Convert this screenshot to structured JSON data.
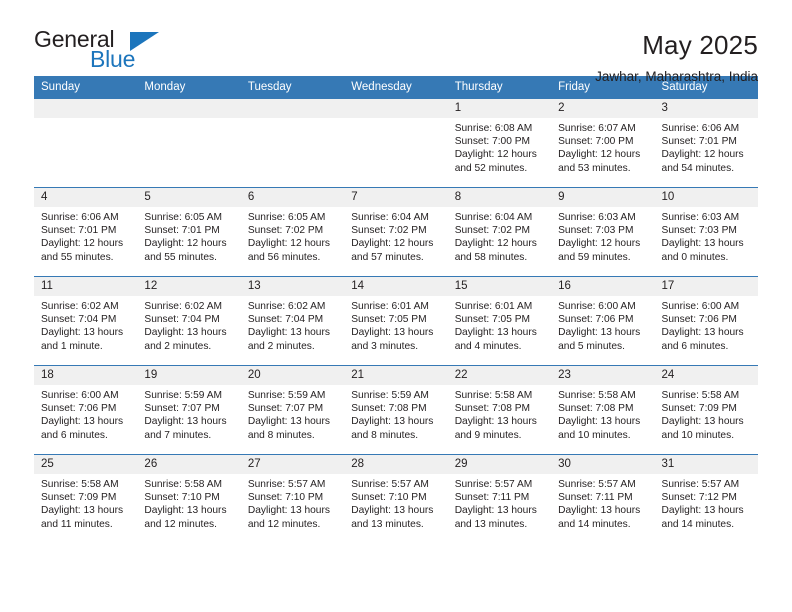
{
  "brand": {
    "name_part1": "General",
    "name_part2": "Blue",
    "accent_color": "#1c75bc"
  },
  "header": {
    "title": "May 2025",
    "subtitle": "Jawhar, Maharashtra, India"
  },
  "theme": {
    "header_bg": "#3679b5",
    "daynum_bg": "#f0f0f0",
    "text": "#231f20"
  },
  "weekday_headers": [
    "Sunday",
    "Monday",
    "Tuesday",
    "Wednesday",
    "Thursday",
    "Friday",
    "Saturday"
  ],
  "labels": {
    "sunrise_prefix": "Sunrise:",
    "sunset_prefix": "Sunset:",
    "daylight_prefix": "Daylight:"
  },
  "weeks": [
    [
      {
        "day": "",
        "empty": true,
        "lines": []
      },
      {
        "day": "",
        "empty": true,
        "lines": []
      },
      {
        "day": "",
        "empty": true,
        "lines": []
      },
      {
        "day": "",
        "empty": true,
        "lines": []
      },
      {
        "day": "1",
        "empty": false,
        "lines": [
          "Sunrise: 6:08 AM",
          "Sunset: 7:00 PM",
          "Daylight: 12 hours",
          "and 52 minutes."
        ]
      },
      {
        "day": "2",
        "empty": false,
        "lines": [
          "Sunrise: 6:07 AM",
          "Sunset: 7:00 PM",
          "Daylight: 12 hours",
          "and 53 minutes."
        ]
      },
      {
        "day": "3",
        "empty": false,
        "lines": [
          "Sunrise: 6:06 AM",
          "Sunset: 7:01 PM",
          "Daylight: 12 hours",
          "and 54 minutes."
        ]
      }
    ],
    [
      {
        "day": "4",
        "empty": false,
        "lines": [
          "Sunrise: 6:06 AM",
          "Sunset: 7:01 PM",
          "Daylight: 12 hours",
          "and 55 minutes."
        ]
      },
      {
        "day": "5",
        "empty": false,
        "lines": [
          "Sunrise: 6:05 AM",
          "Sunset: 7:01 PM",
          "Daylight: 12 hours",
          "and 55 minutes."
        ]
      },
      {
        "day": "6",
        "empty": false,
        "lines": [
          "Sunrise: 6:05 AM",
          "Sunset: 7:02 PM",
          "Daylight: 12 hours",
          "and 56 minutes."
        ]
      },
      {
        "day": "7",
        "empty": false,
        "lines": [
          "Sunrise: 6:04 AM",
          "Sunset: 7:02 PM",
          "Daylight: 12 hours",
          "and 57 minutes."
        ]
      },
      {
        "day": "8",
        "empty": false,
        "lines": [
          "Sunrise: 6:04 AM",
          "Sunset: 7:02 PM",
          "Daylight: 12 hours",
          "and 58 minutes."
        ]
      },
      {
        "day": "9",
        "empty": false,
        "lines": [
          "Sunrise: 6:03 AM",
          "Sunset: 7:03 PM",
          "Daylight: 12 hours",
          "and 59 minutes."
        ]
      },
      {
        "day": "10",
        "empty": false,
        "lines": [
          "Sunrise: 6:03 AM",
          "Sunset: 7:03 PM",
          "Daylight: 13 hours",
          "and 0 minutes."
        ]
      }
    ],
    [
      {
        "day": "11",
        "empty": false,
        "lines": [
          "Sunrise: 6:02 AM",
          "Sunset: 7:04 PM",
          "Daylight: 13 hours",
          "and 1 minute."
        ]
      },
      {
        "day": "12",
        "empty": false,
        "lines": [
          "Sunrise: 6:02 AM",
          "Sunset: 7:04 PM",
          "Daylight: 13 hours",
          "and 2 minutes."
        ]
      },
      {
        "day": "13",
        "empty": false,
        "lines": [
          "Sunrise: 6:02 AM",
          "Sunset: 7:04 PM",
          "Daylight: 13 hours",
          "and 2 minutes."
        ]
      },
      {
        "day": "14",
        "empty": false,
        "lines": [
          "Sunrise: 6:01 AM",
          "Sunset: 7:05 PM",
          "Daylight: 13 hours",
          "and 3 minutes."
        ]
      },
      {
        "day": "15",
        "empty": false,
        "lines": [
          "Sunrise: 6:01 AM",
          "Sunset: 7:05 PM",
          "Daylight: 13 hours",
          "and 4 minutes."
        ]
      },
      {
        "day": "16",
        "empty": false,
        "lines": [
          "Sunrise: 6:00 AM",
          "Sunset: 7:06 PM",
          "Daylight: 13 hours",
          "and 5 minutes."
        ]
      },
      {
        "day": "17",
        "empty": false,
        "lines": [
          "Sunrise: 6:00 AM",
          "Sunset: 7:06 PM",
          "Daylight: 13 hours",
          "and 6 minutes."
        ]
      }
    ],
    [
      {
        "day": "18",
        "empty": false,
        "lines": [
          "Sunrise: 6:00 AM",
          "Sunset: 7:06 PM",
          "Daylight: 13 hours",
          "and 6 minutes."
        ]
      },
      {
        "day": "19",
        "empty": false,
        "lines": [
          "Sunrise: 5:59 AM",
          "Sunset: 7:07 PM",
          "Daylight: 13 hours",
          "and 7 minutes."
        ]
      },
      {
        "day": "20",
        "empty": false,
        "lines": [
          "Sunrise: 5:59 AM",
          "Sunset: 7:07 PM",
          "Daylight: 13 hours",
          "and 8 minutes."
        ]
      },
      {
        "day": "21",
        "empty": false,
        "lines": [
          "Sunrise: 5:59 AM",
          "Sunset: 7:08 PM",
          "Daylight: 13 hours",
          "and 8 minutes."
        ]
      },
      {
        "day": "22",
        "empty": false,
        "lines": [
          "Sunrise: 5:58 AM",
          "Sunset: 7:08 PM",
          "Daylight: 13 hours",
          "and 9 minutes."
        ]
      },
      {
        "day": "23",
        "empty": false,
        "lines": [
          "Sunrise: 5:58 AM",
          "Sunset: 7:08 PM",
          "Daylight: 13 hours",
          "and 10 minutes."
        ]
      },
      {
        "day": "24",
        "empty": false,
        "lines": [
          "Sunrise: 5:58 AM",
          "Sunset: 7:09 PM",
          "Daylight: 13 hours",
          "and 10 minutes."
        ]
      }
    ],
    [
      {
        "day": "25",
        "empty": false,
        "lines": [
          "Sunrise: 5:58 AM",
          "Sunset: 7:09 PM",
          "Daylight: 13 hours",
          "and 11 minutes."
        ]
      },
      {
        "day": "26",
        "empty": false,
        "lines": [
          "Sunrise: 5:58 AM",
          "Sunset: 7:10 PM",
          "Daylight: 13 hours",
          "and 12 minutes."
        ]
      },
      {
        "day": "27",
        "empty": false,
        "lines": [
          "Sunrise: 5:57 AM",
          "Sunset: 7:10 PM",
          "Daylight: 13 hours",
          "and 12 minutes."
        ]
      },
      {
        "day": "28",
        "empty": false,
        "lines": [
          "Sunrise: 5:57 AM",
          "Sunset: 7:10 PM",
          "Daylight: 13 hours",
          "and 13 minutes."
        ]
      },
      {
        "day": "29",
        "empty": false,
        "lines": [
          "Sunrise: 5:57 AM",
          "Sunset: 7:11 PM",
          "Daylight: 13 hours",
          "and 13 minutes."
        ]
      },
      {
        "day": "30",
        "empty": false,
        "lines": [
          "Sunrise: 5:57 AM",
          "Sunset: 7:11 PM",
          "Daylight: 13 hours",
          "and 14 minutes."
        ]
      },
      {
        "day": "31",
        "empty": false,
        "lines": [
          "Sunrise: 5:57 AM",
          "Sunset: 7:12 PM",
          "Daylight: 13 hours",
          "and 14 minutes."
        ]
      }
    ]
  ]
}
